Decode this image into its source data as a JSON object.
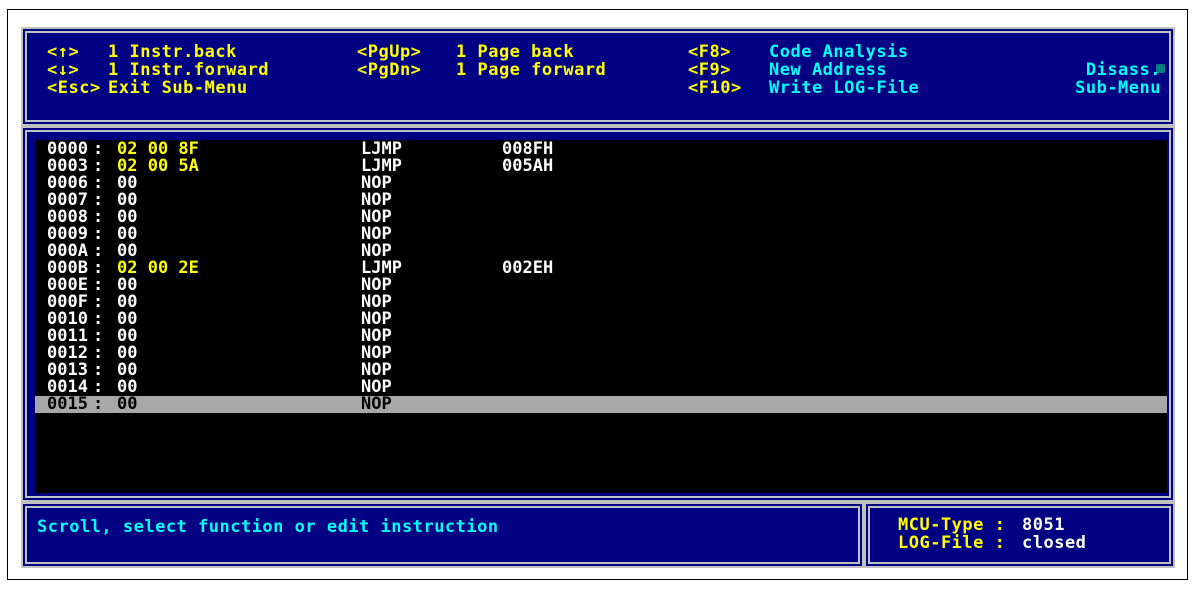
{
  "header": {
    "keys": [
      {
        "key": "<↑>",
        "text": "1 Instr.back"
      },
      {
        "key": "<↓>",
        "text": "1 Instr.forward"
      },
      {
        "key": "<Esc>",
        "text": "Exit Sub-Menu"
      },
      {
        "key": "<PgUp>",
        "text": "1 Page back"
      },
      {
        "key": "<PgDn>",
        "text": "1 Page forward"
      },
      {
        "key": "<F8>",
        "text": "Code Analysis"
      },
      {
        "key": "<F9>",
        "text": "New Address"
      },
      {
        "key": "<F10>",
        "text": "Write LOG-File"
      }
    ],
    "submenu_line1": "Disass.",
    "submenu_line2": "Sub-Menu"
  },
  "listing": {
    "rows": [
      {
        "addr": "0000",
        "bytes": "02 00 8F",
        "mnemonic": "LJMP",
        "operand": "008FH"
      },
      {
        "addr": "0003",
        "bytes": "02 00 5A",
        "mnemonic": "LJMP",
        "operand": "005AH"
      },
      {
        "addr": "0006",
        "bytes": "00",
        "mnemonic": "NOP",
        "operand": ""
      },
      {
        "addr": "0007",
        "bytes": "00",
        "mnemonic": "NOP",
        "operand": ""
      },
      {
        "addr": "0008",
        "bytes": "00",
        "mnemonic": "NOP",
        "operand": ""
      },
      {
        "addr": "0009",
        "bytes": "00",
        "mnemonic": "NOP",
        "operand": ""
      },
      {
        "addr": "000A",
        "bytes": "00",
        "mnemonic": "NOP",
        "operand": ""
      },
      {
        "addr": "000B",
        "bytes": "02 00 2E",
        "mnemonic": "LJMP",
        "operand": "002EH"
      },
      {
        "addr": "000E",
        "bytes": "00",
        "mnemonic": "NOP",
        "operand": ""
      },
      {
        "addr": "000F",
        "bytes": "00",
        "mnemonic": "NOP",
        "operand": ""
      },
      {
        "addr": "0010",
        "bytes": "00",
        "mnemonic": "NOP",
        "operand": ""
      },
      {
        "addr": "0011",
        "bytes": "00",
        "mnemonic": "NOP",
        "operand": ""
      },
      {
        "addr": "0012",
        "bytes": "00",
        "mnemonic": "NOP",
        "operand": ""
      },
      {
        "addr": "0013",
        "bytes": "00",
        "mnemonic": "NOP",
        "operand": ""
      },
      {
        "addr": "0014",
        "bytes": "00",
        "mnemonic": "NOP",
        "operand": ""
      },
      {
        "addr": "0015",
        "bytes": "00",
        "mnemonic": "NOP",
        "operand": "",
        "selected": true
      }
    ]
  },
  "status": {
    "message": "Scroll, select function or edit instruction"
  },
  "info": {
    "mcu_label": "MCU-Type : ",
    "mcu_value": "8051",
    "log_label": "LOG-File : ",
    "log_value": "closed"
  },
  "colors": {
    "background": "#000082",
    "key_color": "#ffff00",
    "text_color": "#00ffff",
    "multibyte_color": "#ffff00",
    "selection": "#a8a8a8"
  }
}
